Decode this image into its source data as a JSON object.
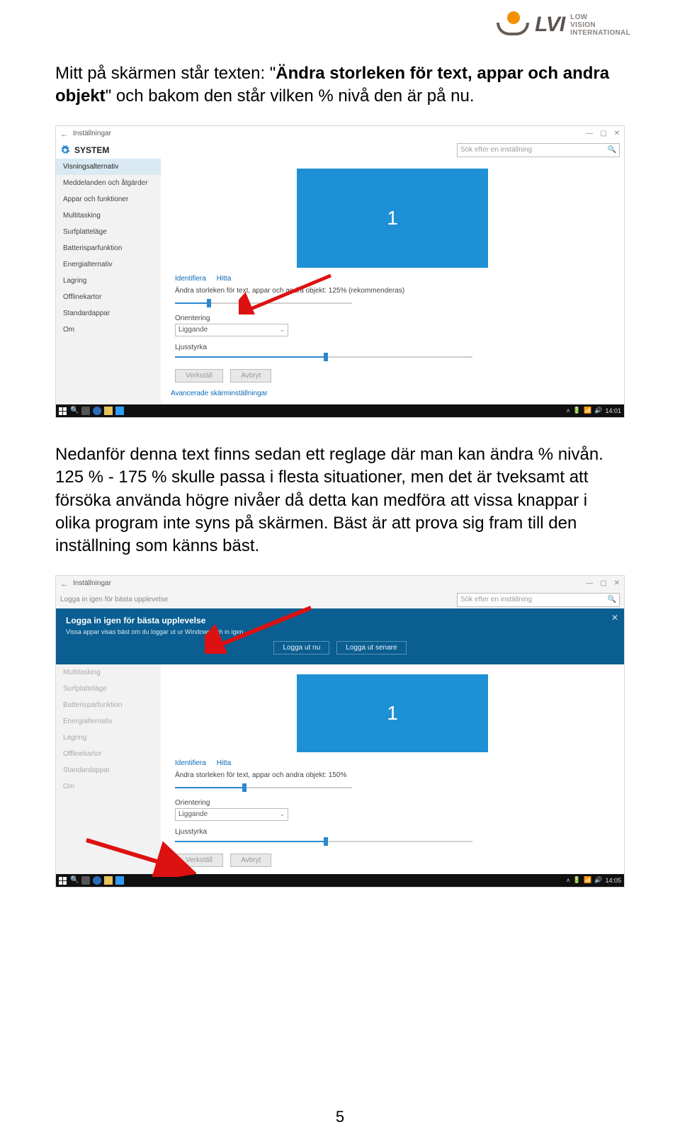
{
  "logo": {
    "brand": "LVI",
    "tagline_line1": "LOW",
    "tagline_line2": "VISION",
    "tagline_line3": "INTERNATIONAL"
  },
  "paragraph1_pre": "Mitt på skärmen står texten: \"",
  "paragraph1_bold": "Ändra storleken för text, appar och andra objekt",
  "paragraph1_post": "\" och bakom den står vilken % nivå den är på nu.",
  "paragraph2": "Nedanför denna text finns sedan ett reglage där man kan ändra % nivån. 125 % - 175 % skulle passa i flesta situationer, men det är tveksamt att försöka använda högre nivåer då detta kan medföra att vissa knappar i olika program inte syns på skärmen. Bäst är att prova sig fram till den inställning som känns bäst.",
  "page_number": "5",
  "settings_app": {
    "window_title": "Inställningar",
    "system_title": "SYSTEM",
    "search_placeholder": "Sök efter en inställning",
    "sidebar_items": [
      "Visningsalternativ",
      "Meddelanden och åtgärder",
      "Appar och funktioner",
      "Multitasking",
      "Surfplatteläge",
      "Batterisparfunktion",
      "Energialternativ",
      "Lagring",
      "Offlinekartor",
      "Standardappar",
      "Om"
    ],
    "monitor_id": "1",
    "identify": "Identifiera",
    "hitta": "Hitta",
    "scale_text_125": "Ändra storleken för text, appar och andra objekt: 125% (rekommenderas)",
    "scale_text_150": "Ändra storleken för text, appar och andra objekt: 150%",
    "orientation_label": "Orientering",
    "orientation_value": "Liggande",
    "brightness_label": "Ljusstyrka",
    "apply_btn": "Verkställ",
    "cancel_btn": "Avbryt",
    "advanced_link": "Avancerade skärminställningar"
  },
  "banner": {
    "title": "Logga in igen för bästa upplevelse",
    "subtitle": "Vissa appar visas bäst om du loggar ut ur Windows och in igen.",
    "btn_now": "Logga ut nu",
    "btn_later": "Logga ut senare"
  },
  "taskbar": {
    "time1": "14:01",
    "time2": "14:05"
  }
}
